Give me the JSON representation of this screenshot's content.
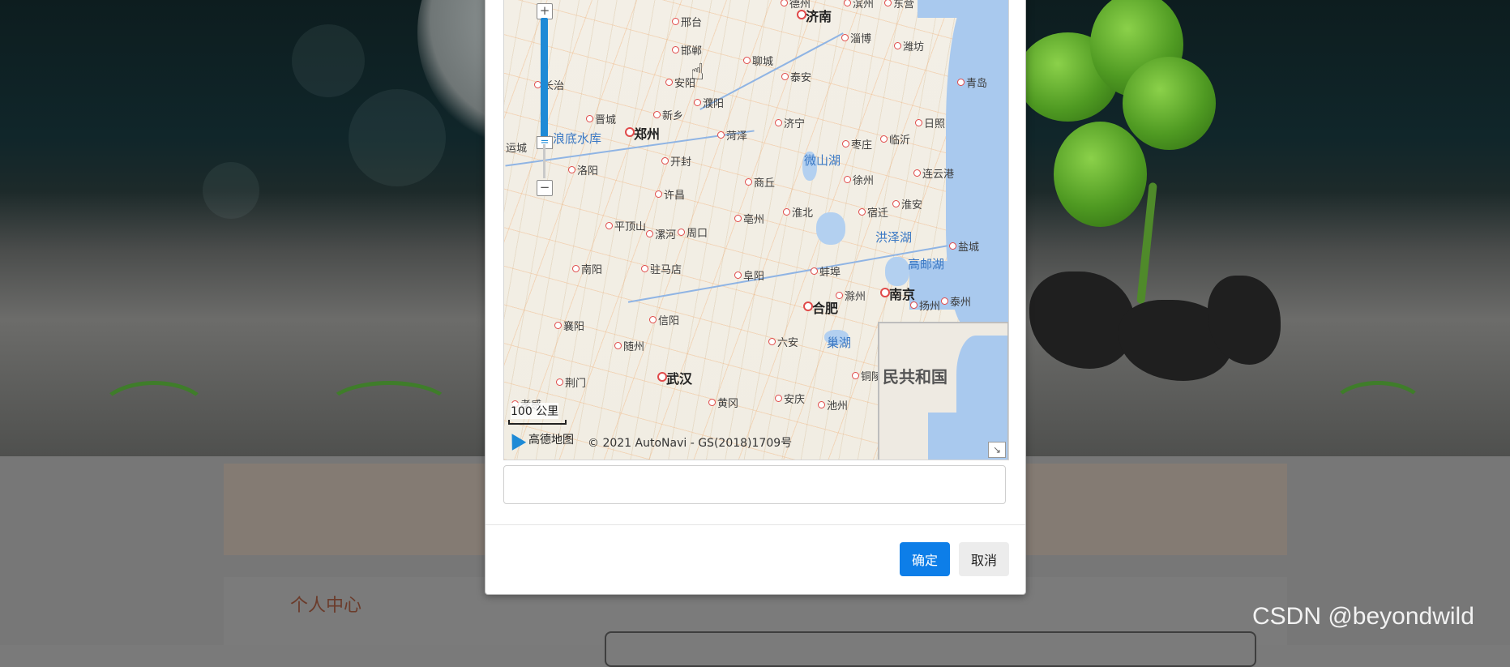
{
  "modal": {
    "confirm_label": "确定",
    "cancel_label": "取消",
    "address_value": ""
  },
  "map": {
    "scale_label": "100 公里",
    "logo_text": "高德地图",
    "copyright": "© 2021 AutoNavi - GS(2018)1709号",
    "overview_label": "民共和国",
    "zoom_in": "+",
    "zoom_out": "−",
    "cities_major": [
      "济南",
      "郑州",
      "合肥",
      "南京",
      "武汉"
    ],
    "cities": [
      "邢台",
      "邯郸",
      "长治",
      "安阳",
      "聊城",
      "泰安",
      "淄博",
      "潍坊",
      "青岛",
      "滨州",
      "东营",
      "德州",
      "晋城",
      "新乡",
      "濮阳",
      "济宁",
      "日照",
      "运城",
      "洛阳",
      "开封",
      "菏泽",
      "枣庄",
      "临沂",
      "连云港",
      "商丘",
      "徐州",
      "许昌",
      "平顶山",
      "漯河",
      "周口",
      "亳州",
      "淮北",
      "宿迁",
      "淮安",
      "盐城",
      "南阳",
      "驻马店",
      "阜阳",
      "蚌埠",
      "滁州",
      "扬州",
      "泰州",
      "襄阳",
      "信阳",
      "六安",
      "随州",
      "荆门",
      "孝感",
      "黄冈",
      "安庆",
      "池州",
      "铜陵"
    ],
    "water_labels": [
      "小浪底水库",
      "微山湖",
      "洪泽湖",
      "高邮湖",
      "巢湖"
    ]
  },
  "background": {
    "section_title": "个人中心",
    "watermark": "CSDN @beyondwild"
  }
}
